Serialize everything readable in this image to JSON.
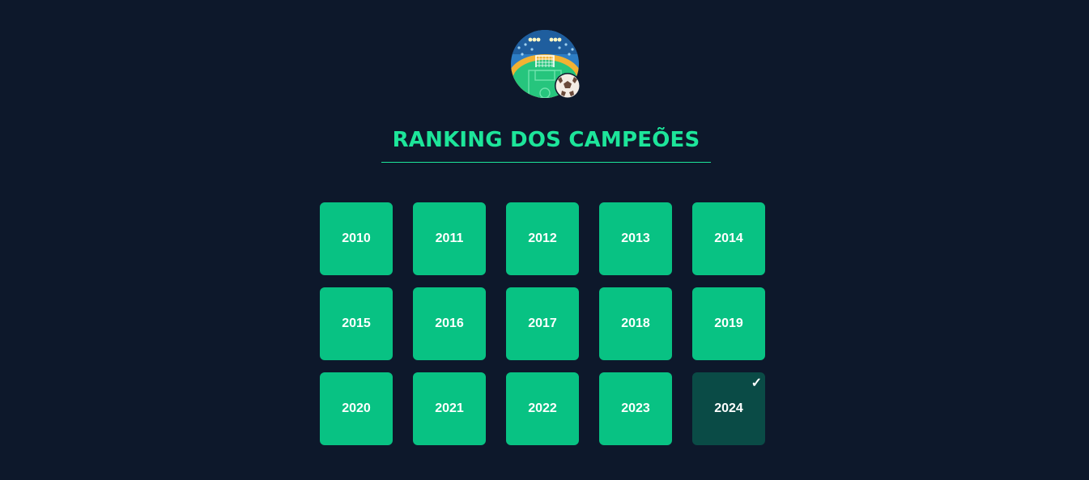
{
  "header": {
    "logo_icon": "stadium-football-icon",
    "title": "RANKING DOS CAMPEÕES",
    "title_color": "#1de59a"
  },
  "years": [
    {
      "label": "2010",
      "selected": false
    },
    {
      "label": "2011",
      "selected": false
    },
    {
      "label": "2012",
      "selected": false
    },
    {
      "label": "2013",
      "selected": false
    },
    {
      "label": "2014",
      "selected": false
    },
    {
      "label": "2015",
      "selected": false
    },
    {
      "label": "2016",
      "selected": false
    },
    {
      "label": "2017",
      "selected": false
    },
    {
      "label": "2018",
      "selected": false
    },
    {
      "label": "2019",
      "selected": false
    },
    {
      "label": "2020",
      "selected": false
    },
    {
      "label": "2021",
      "selected": false
    },
    {
      "label": "2022",
      "selected": false
    },
    {
      "label": "2023",
      "selected": false
    },
    {
      "label": "2024",
      "selected": true
    }
  ],
  "selected_marker": "✓",
  "colors": {
    "background": "#0d182b",
    "tile": "#08c283",
    "tile_selected": "#0a4b46"
  }
}
